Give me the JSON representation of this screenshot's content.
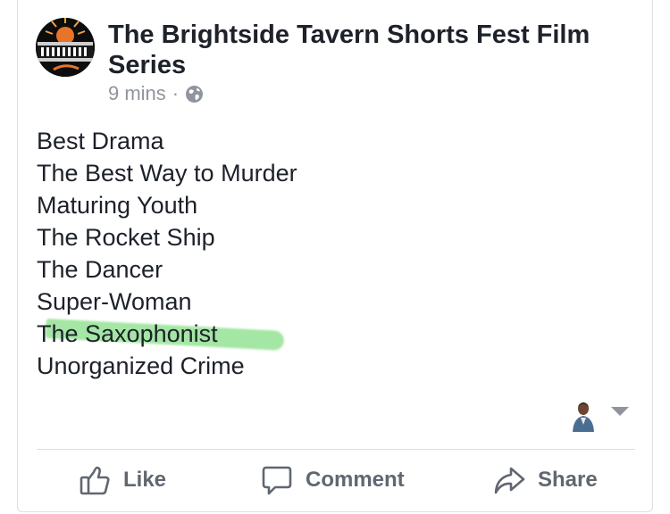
{
  "post": {
    "page_name": "The Brightside Tavern Shorts Fest Film Series",
    "timestamp": "9 mins",
    "separator": "·",
    "privacy_icon": "globe-icon",
    "lines": [
      "Best Drama",
      "The Best Way to Murder",
      "Maturing Youth",
      "The Rocket Ship",
      "The Dancer",
      "Super-Woman",
      "The Saxophonist",
      "Unorganized Crime"
    ],
    "highlighted_line": "The Saxophonist",
    "highlight_color": "#5ad25a"
  },
  "actions": {
    "like_label": "Like",
    "comment_label": "Comment",
    "share_label": "Share"
  },
  "colors": {
    "text": "#1d2129",
    "secondary": "#90949c",
    "action_text": "#606770",
    "border": "#dddfe2"
  }
}
